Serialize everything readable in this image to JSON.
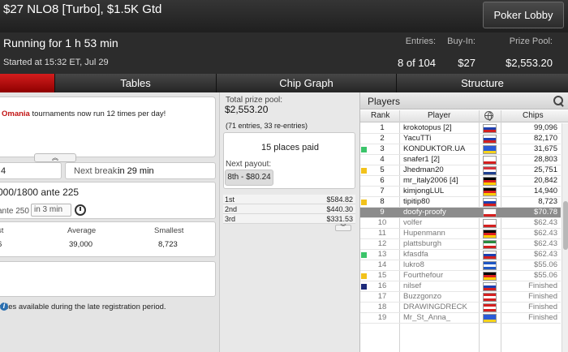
{
  "header": {
    "title": "$27 NLO8 [Turbo], $1.5K Gtd",
    "lobby_button": "Poker Lobby",
    "running": "Running for 1 h 53 min",
    "started": "Started at 15:32 ET, Jul 29",
    "stats": [
      {
        "label": "Entries:",
        "value": "8 of 104"
      },
      {
        "label": "Buy-In:",
        "value": "$27"
      },
      {
        "label": "Prize Pool:",
        "value": "$2,553.20"
      }
    ]
  },
  "tabs": [
    {
      "label": "",
      "active": true
    },
    {
      "label": "Tables"
    },
    {
      "label": "Chip Graph"
    },
    {
      "label": "Structure"
    }
  ],
  "news": {
    "brand": "Omania",
    "text": " tournaments now run 12 times per day!",
    "expand_glyph": "︽"
  },
  "level": {
    "value": "4"
  },
  "break": {
    "label": "Next break:",
    "value": "in 29 min"
  },
  "blinds": {
    "current": "000/1800 ante 225",
    "next": "ante 250",
    "timer": "in 3 min"
  },
  "stacks": {
    "headers": [
      "st",
      "Average",
      "Smallest"
    ],
    "values": [
      "6",
      "39,000",
      "8,723"
    ]
  },
  "late_reg": {
    "text": "ntries available during the late registration period.",
    "info_glyph": "i"
  },
  "prize": {
    "total_label": "Total prize pool:",
    "total_value": "$2,553.20",
    "entries_note": "(71 entries, 33 re-entries)",
    "places_paid": "15 places paid",
    "next_payout_label": "Next payout:",
    "next_payout_value": "8th - $80.24",
    "payouts": [
      {
        "place": "1st",
        "amount": "$584.82"
      },
      {
        "place": "2nd",
        "amount": "$440.30"
      },
      {
        "place": "3rd",
        "amount": "$331.53"
      }
    ],
    "collapse_glyph": "︾"
  },
  "players": {
    "title": "Players",
    "columns": {
      "rank": "Rank",
      "player": "Player",
      "chips": "Chips"
    },
    "rows": [
      {
        "rank": "1",
        "name": "krokotopus [2]",
        "chips": "99,096",
        "flag": [
          "#ffffff",
          "#1c3fb0",
          "#d41f1f"
        ],
        "marker": ""
      },
      {
        "rank": "2",
        "name": "YacuTTi",
        "chips": "82,170",
        "flag": [
          "#ffffff",
          "#1c3fb0",
          "#d41f1f"
        ],
        "marker": ""
      },
      {
        "rank": "3",
        "name": "KONDUKTOR.UA",
        "chips": "31,675",
        "flag": [
          "#2a5bd7",
          "#2a5bd7",
          "#f6d31b"
        ],
        "marker": "#3bc46a"
      },
      {
        "rank": "4",
        "name": "snafer1 [2]",
        "chips": "28,803",
        "flag": [
          "#ffffff",
          "#ffffff",
          "#d41f1f"
        ],
        "marker": ""
      },
      {
        "rank": "5",
        "name": "Jhedman20",
        "chips": "25,751",
        "flag": [
          "#d9363e",
          "#ffffff",
          "#1f3f8f"
        ],
        "marker": "#f2c21b"
      },
      {
        "rank": "6",
        "name": "mr_italy2006 [4]",
        "chips": "20,842",
        "flag": [
          "#000000",
          "#dd1f1f",
          "#ffcc00"
        ],
        "marker": ""
      },
      {
        "rank": "7",
        "name": "kimjongLUL",
        "chips": "14,940",
        "flag": [
          "#000000",
          "#dd1f1f",
          "#ffcc00"
        ],
        "marker": ""
      },
      {
        "rank": "8",
        "name": "tipitip80",
        "chips": "8,723",
        "flag": [
          "#ffffff",
          "#1c3fb0",
          "#d41f1f"
        ],
        "marker": "#f2c21b"
      },
      {
        "rank": "9",
        "name": "doofy-proofy",
        "chips": "$70.78",
        "flag": [
          "#ffffff",
          "#ffffff",
          "#d41f1f"
        ],
        "marker": "",
        "selected": true
      },
      {
        "rank": "10",
        "name": "volfer",
        "chips": "$62.43",
        "flag": [
          "#ffffff",
          "#ffffff",
          "#d41f1f"
        ],
        "marker": "",
        "out": true
      },
      {
        "rank": "11",
        "name": "Hupenmann",
        "chips": "$62.43",
        "flag": [
          "#000000",
          "#dd1f1f",
          "#ffcc00"
        ],
        "marker": "",
        "out": true
      },
      {
        "rank": "12",
        "name": "plattsburgh",
        "chips": "$62.43",
        "flag": [
          "#2a8a3e",
          "#ffffff",
          "#d41f1f"
        ],
        "marker": "",
        "out": true
      },
      {
        "rank": "13",
        "name": "kfasdfa",
        "chips": "$62.43",
        "flag": [
          "#ffffff",
          "#1c3fb0",
          "#d41f1f"
        ],
        "marker": "#3bc46a",
        "out": true
      },
      {
        "rank": "14",
        "name": "lukro8",
        "chips": "$55.06",
        "flag": [
          "#1f57c4",
          "#ffffff",
          "#1f57c4"
        ],
        "marker": "",
        "out": true
      },
      {
        "rank": "15",
        "name": "Fourthefour",
        "chips": "$55.06",
        "flag": [
          "#000000",
          "#dd1f1f",
          "#ffcc00"
        ],
        "marker": "#f2c21b",
        "out": true
      },
      {
        "rank": "16",
        "name": "nilsef",
        "chips": "Finished",
        "flag": [
          "#ffffff",
          "#1c3fb0",
          "#d41f1f"
        ],
        "marker": "#1c2a7a",
        "out": true
      },
      {
        "rank": "17",
        "name": "Buzzgonzo",
        "chips": "Finished",
        "flag": [
          "#d41f1f",
          "#ffffff",
          "#d41f1f"
        ],
        "marker": "",
        "out": true
      },
      {
        "rank": "18",
        "name": "DRAWINGDRECK",
        "chips": "Finished",
        "flag": [
          "#d41f1f",
          "#ffffff",
          "#d41f1f"
        ],
        "marker": "",
        "out": true
      },
      {
        "rank": "19",
        "name": "Mr_St_Anna_",
        "chips": "Finished",
        "flag": [
          "#2a5bd7",
          "#2a5bd7",
          "#f6d31b"
        ],
        "marker": "",
        "out": true
      }
    ]
  }
}
